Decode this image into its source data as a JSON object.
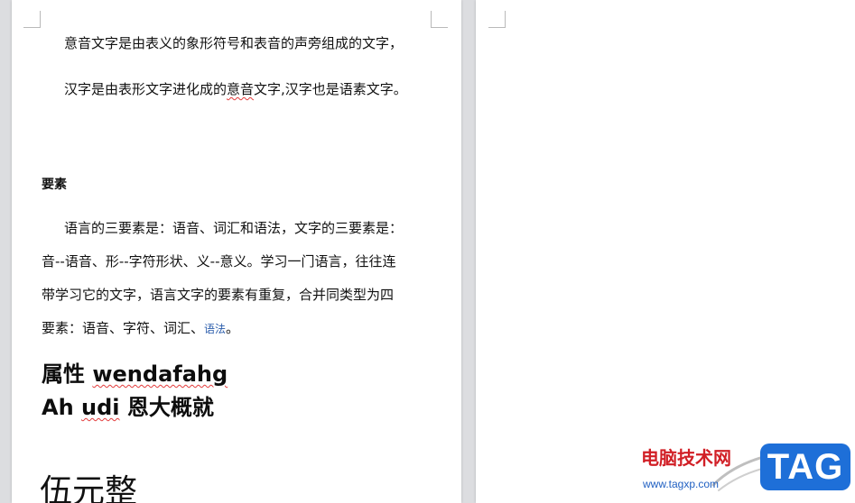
{
  "document": {
    "left_page": {
      "paragraph_1": {
        "line_1": "意音文字是由表义的象形符号和表音的声旁组成的文字，",
        "line_2_pre": "汉字是由表形文字进化成的",
        "line_2_flagged": "意音",
        "line_2_post": "文字,汉字也是语素文字。"
      },
      "section_heading": "要素",
      "paragraph_2": {
        "line_1": "语言的三要素是：语音、词汇和语法，文字的三要素是：",
        "line_2": "音--语音、形--字符形状、义--意义。学习一门语言，往往连",
        "line_3": "带学习它的文字，语言文字的要素有重复，合并同类型为四",
        "line_4_pre": "要素：语音、字符、词汇、",
        "line_4_small": "语法",
        "line_4_post": "。"
      },
      "heading_line_1_pre": "属性 ",
      "heading_line_1_flagged": "wendafahg",
      "heading_line_2_pre": "Ah ",
      "heading_line_2_flagged": "udi",
      "heading_line_2_post": " 恩大概就",
      "large_heading": "伍元整"
    }
  },
  "watermark": {
    "site_name": "电脑技术网",
    "url": "www.tagxp.com",
    "badge": "TAG",
    "colors": {
      "site_name": "#d11f26",
      "url": "#1f5fc2",
      "badge": "#1e6fd8"
    }
  },
  "colors": {
    "canvas_background": "#dcdde0",
    "page": "#ffffff",
    "text": "#111111",
    "spell_check": "#e23b3b"
  }
}
